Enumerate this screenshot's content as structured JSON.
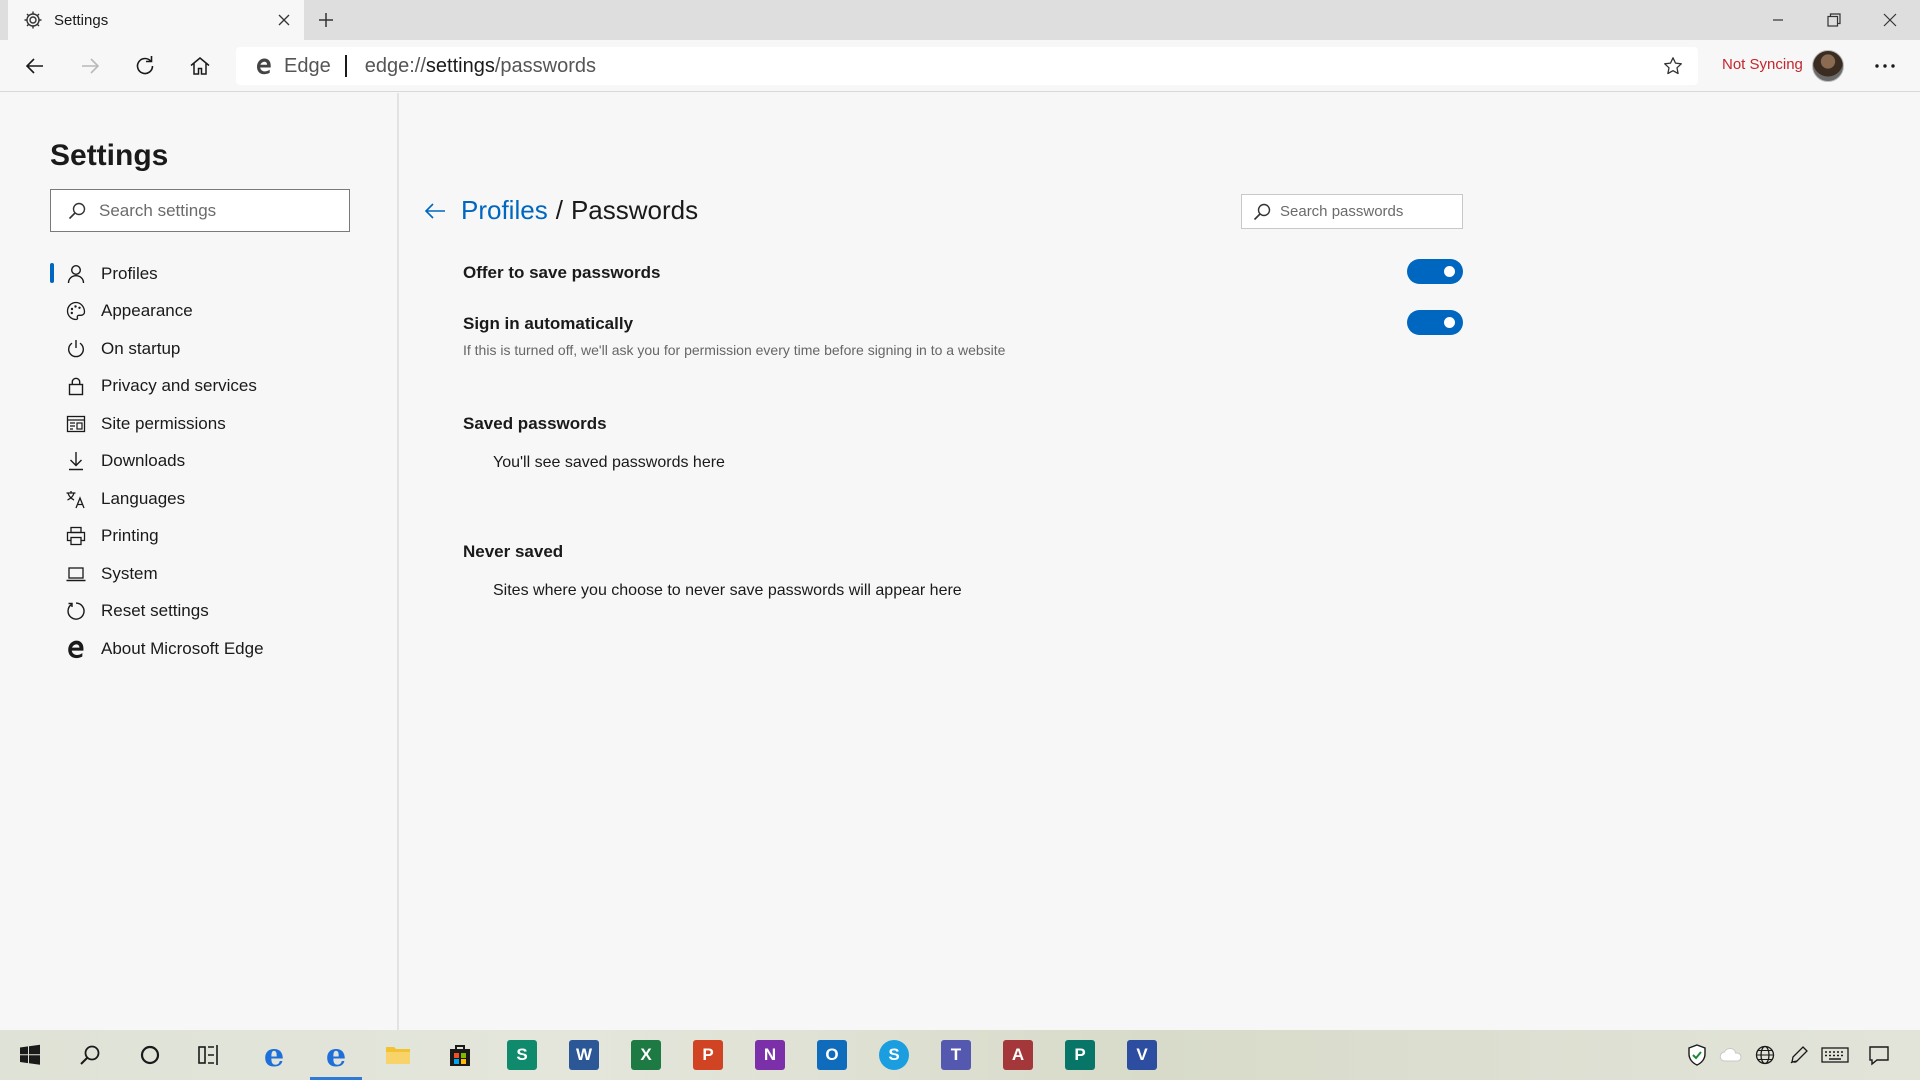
{
  "browser": {
    "tab_title": "Settings",
    "omnibox_site_label": "Edge",
    "url_prefix": "edge://",
    "url_host": "settings",
    "url_path": "/passwords",
    "sync_status": "Not Syncing"
  },
  "sidebar": {
    "title": "Settings",
    "search_placeholder": "Search settings",
    "items": [
      {
        "label": "Profiles",
        "icon": "person-icon",
        "active": true
      },
      {
        "label": "Appearance",
        "icon": "palette-icon"
      },
      {
        "label": "On startup",
        "icon": "power-icon"
      },
      {
        "label": "Privacy and services",
        "icon": "lock-icon"
      },
      {
        "label": "Site permissions",
        "icon": "site-permissions-icon"
      },
      {
        "label": "Downloads",
        "icon": "download-icon"
      },
      {
        "label": "Languages",
        "icon": "languages-icon"
      },
      {
        "label": "Printing",
        "icon": "printer-icon"
      },
      {
        "label": "System",
        "icon": "laptop-icon"
      },
      {
        "label": "Reset settings",
        "icon": "reset-icon"
      },
      {
        "label": "About Microsoft Edge",
        "icon": "edge-logo-icon"
      }
    ]
  },
  "main": {
    "breadcrumb_parent": "Profiles",
    "breadcrumb_separator": "/",
    "breadcrumb_current": "Passwords",
    "search_placeholder": "Search passwords",
    "offer_save_label": "Offer to save passwords",
    "offer_save_on": true,
    "sign_in_label": "Sign in automatically",
    "sign_in_desc": "If this is turned off, we'll ask you for permission every time before signing in to a website",
    "sign_in_on": true,
    "saved_title": "Saved passwords",
    "saved_empty": "You'll see saved passwords here",
    "never_title": "Never saved",
    "never_empty": "Sites where you choose to never save passwords will appear here"
  },
  "taskbar": {
    "apps": [
      {
        "name": "edge-legacy-icon",
        "letter": "e",
        "color": "#1e6fd9"
      },
      {
        "name": "edge-icon",
        "letter": "e",
        "color": "#1e6fd9",
        "active": true
      },
      {
        "name": "file-explorer-icon",
        "color": "#f2c230"
      },
      {
        "name": "store-icon",
        "color": "#1a1a1a"
      },
      {
        "name": "sway-icon",
        "letter": "S",
        "color": "#0f8a6c"
      },
      {
        "name": "word-icon",
        "letter": "W",
        "color": "#2b5797"
      },
      {
        "name": "excel-icon",
        "letter": "X",
        "color": "#1d7a43"
      },
      {
        "name": "powerpoint-icon",
        "letter": "P",
        "color": "#d04423"
      },
      {
        "name": "onenote-icon",
        "letter": "N",
        "color": "#7b2fa8"
      },
      {
        "name": "outlook-icon",
        "letter": "O",
        "color": "#0f6cbd"
      },
      {
        "name": "skype-icon",
        "letter": "S",
        "color": "#1b9ee0"
      },
      {
        "name": "teams-icon",
        "letter": "T",
        "color": "#5558af"
      },
      {
        "name": "access-icon",
        "letter": "A",
        "color": "#a4373a"
      },
      {
        "name": "publisher-icon",
        "letter": "P",
        "color": "#077568"
      },
      {
        "name": "visio-icon",
        "letter": "V",
        "color": "#2d4da0"
      }
    ]
  }
}
